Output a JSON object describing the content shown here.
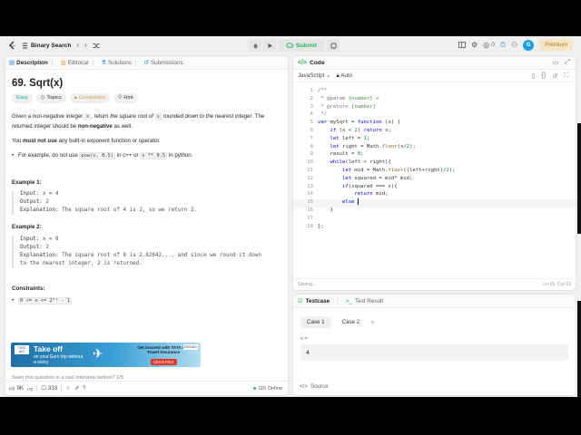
{
  "topbar": {
    "list_title": "Binary Search",
    "submit_label": "Submit",
    "coin_count": "0",
    "premium_label": "Premium",
    "avatar_letter": "G"
  },
  "left_tabs": [
    {
      "label": "Description",
      "icon": "document-icon"
    },
    {
      "label": "Editorial",
      "icon": "book-icon"
    },
    {
      "label": "Solutions",
      "icon": "flask-icon"
    },
    {
      "label": "Submissions",
      "icon": "history-icon"
    }
  ],
  "problem": {
    "title": "69. Sqrt(x)",
    "difficulty": "Easy",
    "topics_label": "Topics",
    "companies_label": "Companies",
    "hint_label": "Hint",
    "desc_1_a": "Given a non-negative integer ",
    "desc_1_code": "x",
    "desc_1_b": ", return ",
    "desc_1_em1": "the square root of ",
    "desc_1_code2": "x",
    "desc_1_em2": " rounded down to the nearest integer",
    "desc_1_c": ". The returned integer should be ",
    "desc_1_bold": "non-negative",
    "desc_1_d": " as well.",
    "desc_2_a": "You ",
    "desc_2_bold": "must not use",
    "desc_2_b": " any built-in exponent function or operator.",
    "bullet_a": "For example, do not use ",
    "bullet_code1": "pow(x, 0.5)",
    "bullet_b": " in c++ or ",
    "bullet_code2": "x ** 0.5",
    "bullet_c": " in python.",
    "examples": [
      {
        "heading": "Example 1:",
        "input": "x = 4",
        "output": "2",
        "explanation": "The square root of 4 is 2, so we return 2."
      },
      {
        "heading": "Example 2:",
        "input": "x = 8",
        "output": "2",
        "explanation_1": "The square root of 8 is 2.82842..., and since we round it down",
        "explanation_2": "to the nearest integer, 2 is returned."
      }
    ],
    "labels": {
      "input": "Input:",
      "output": "Output:",
      "explanation": "Explanation:"
    },
    "constraints_heading": "Constraints:",
    "constraint": "0 <= x <= 2³¹ - 1",
    "seen_text": "Seen this question in a real interview before?   1/5"
  },
  "ad": {
    "logo_text": "TATA AIG",
    "headline_1": "Take off",
    "headline_2": "on your Euro trip without a worry",
    "right_1": "Get insured with TATA AIG Travel Insurance",
    "cta": "Check Price",
    "badge": "TATA AIG"
  },
  "bottombar": {
    "likes": "9K",
    "comments": "333",
    "online": "115 Online"
  },
  "code_panel": {
    "title": "Code",
    "language": "JavaScript",
    "mode": "Auto",
    "status_left": "Saving...",
    "status_right": "Ln 15, Col 19",
    "line_numbers": [
      "1",
      "2",
      "3",
      "4",
      "5",
      "6",
      "7",
      "8",
      "9",
      "10",
      "11",
      "12",
      "13",
      "14",
      "15",
      "16",
      "17",
      "18"
    ]
  },
  "testcase_panel": {
    "tab_testcase": "Testcase",
    "tab_result": "Test Result",
    "cases": [
      "Case 1",
      "Case 2"
    ],
    "var_label": "x =",
    "var_value": "4",
    "source_label": "Source"
  }
}
